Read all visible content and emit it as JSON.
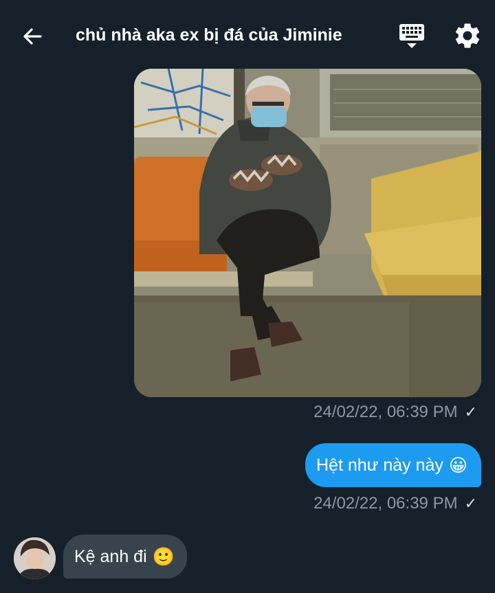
{
  "header": {
    "title": "chủ nhà aka ex bị đá của Jiminie",
    "back_icon": "arrow-left-icon",
    "keyboard_icon": "keyboard-icon",
    "settings_icon": "gear-icon"
  },
  "messages": [
    {
      "type": "image",
      "direction": "sent",
      "timestamp": "24/02/22, 06:39 PM",
      "status": "✓"
    },
    {
      "type": "text",
      "direction": "sent",
      "text": "Hệt như này này",
      "emoji": "😀",
      "timestamp": "24/02/22, 06:39 PM",
      "status": "✓"
    },
    {
      "type": "text",
      "direction": "received",
      "text": "Kệ anh đi",
      "emoji": "🙂"
    }
  ],
  "colors": {
    "background": "#15202b",
    "sent_bubble": "#1d9bf0",
    "received_bubble": "#38444d",
    "timestamp": "#8b98a5"
  }
}
